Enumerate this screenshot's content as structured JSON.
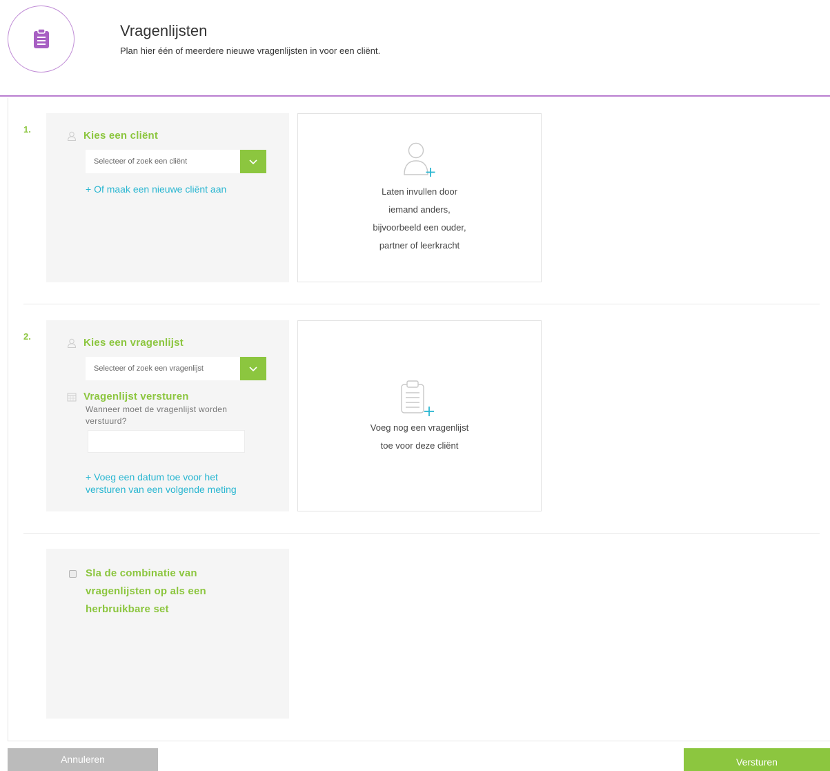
{
  "header": {
    "icon": "clipboard-icon",
    "title": "Vragenlijsten",
    "subtitle": "Plan hier één of meerdere nieuwe vragenlijsten in voor een cliënt."
  },
  "step1": {
    "number": "1.",
    "label_icon": "person-icon",
    "label": "Kies een cliënt",
    "select_placeholder": "Selecteer of zoek een cliënt",
    "new_client_link": "+ Of maak een nieuwe cliënt aan",
    "card_icon": "add-person-icon",
    "card_lines": [
      "Laten invullen door",
      "iemand anders,",
      "bijvoorbeeld een ouder,",
      "partner of leerkracht"
    ]
  },
  "step2": {
    "number": "2.",
    "label_icon": "person-icon",
    "label": "Kies een vragenlijst",
    "select_placeholder": "Selecteer of zoek een vragenlijst",
    "send_icon": "calendar-icon",
    "send_label": "Vragenlijst versturen",
    "send_question_lines": [
      "Wanneer moet de vragenlijst worden",
      "verstuurd?"
    ],
    "date_value": "",
    "add_date_link_lines": [
      "+ Voeg een datum toe voor het",
      "versturen van een volgende meting"
    ],
    "card_icon": "add-clipboard-icon",
    "card_lines": [
      "Voeg nog een vragenlijst",
      "toe voor deze cliënt"
    ]
  },
  "save_set": {
    "checked": false,
    "label_lines": [
      "Sla de combinatie van",
      "vragenlijsten op als een",
      "herbruikbare set"
    ]
  },
  "buttons": {
    "cancel": "Annuleren",
    "send": "Versturen"
  },
  "colors": {
    "accent_green": "#8cc63f",
    "accent_purple": "#b97ed0",
    "link_blue": "#29b6d1",
    "panel_gray": "#f5f5f5"
  }
}
